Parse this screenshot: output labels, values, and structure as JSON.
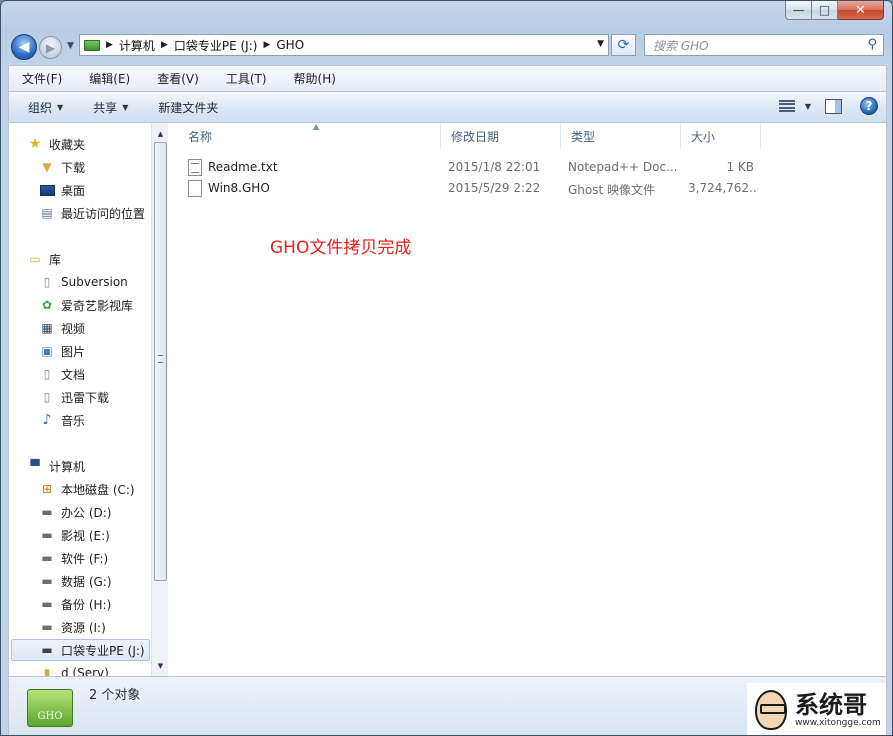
{
  "window": {
    "caption_min": "—",
    "caption_max": "□",
    "caption_close": "✕"
  },
  "address": {
    "segments": [
      "计算机",
      "口袋专业PE (J:)",
      "GHO"
    ]
  },
  "search": {
    "placeholder": "搜索 GHO"
  },
  "menu": [
    "文件(F)",
    "编辑(E)",
    "查看(V)",
    "工具(T)",
    "帮助(H)"
  ],
  "toolbar": {
    "organize": "组织",
    "share": "共享",
    "new_folder": "新建文件夹"
  },
  "nav": {
    "favorites": {
      "title": "收藏夹",
      "items": [
        "下载",
        "桌面",
        "最近访问的位置"
      ]
    },
    "library": {
      "title": "库",
      "items": [
        "Subversion",
        "爱奇艺影视库",
        "视频",
        "图片",
        "文档",
        "迅雷下载",
        "音乐"
      ]
    },
    "computer": {
      "title": "计算机",
      "items": [
        "本地磁盘 (C:)",
        "办公 (D:)",
        "影视 (E:)",
        "软件 (F:)",
        "数据 (G:)",
        "备份 (H:)",
        "资源 (I:)",
        "口袋专业PE (J:)",
        "d (Serv)"
      ]
    }
  },
  "columns": [
    "名称",
    "修改日期",
    "类型",
    "大小"
  ],
  "files": [
    {
      "name": "Readme.txt",
      "date": "2015/1/8 22:01",
      "type": "Notepad++ Doc...",
      "size": "1 KB"
    },
    {
      "name": "Win8.GHO",
      "date": "2015/5/29 2:22",
      "type": "Ghost 映像文件",
      "size": "3,724,762..."
    }
  ],
  "notice": "GHO文件拷贝完成",
  "status": {
    "count": "2 个对象",
    "icon_label": "GHO"
  },
  "logo": {
    "name": "系统哥",
    "url": "www.xitongge.com"
  },
  "colors": {
    "notice": "#e5211b",
    "accent": "#2d6cc7"
  }
}
